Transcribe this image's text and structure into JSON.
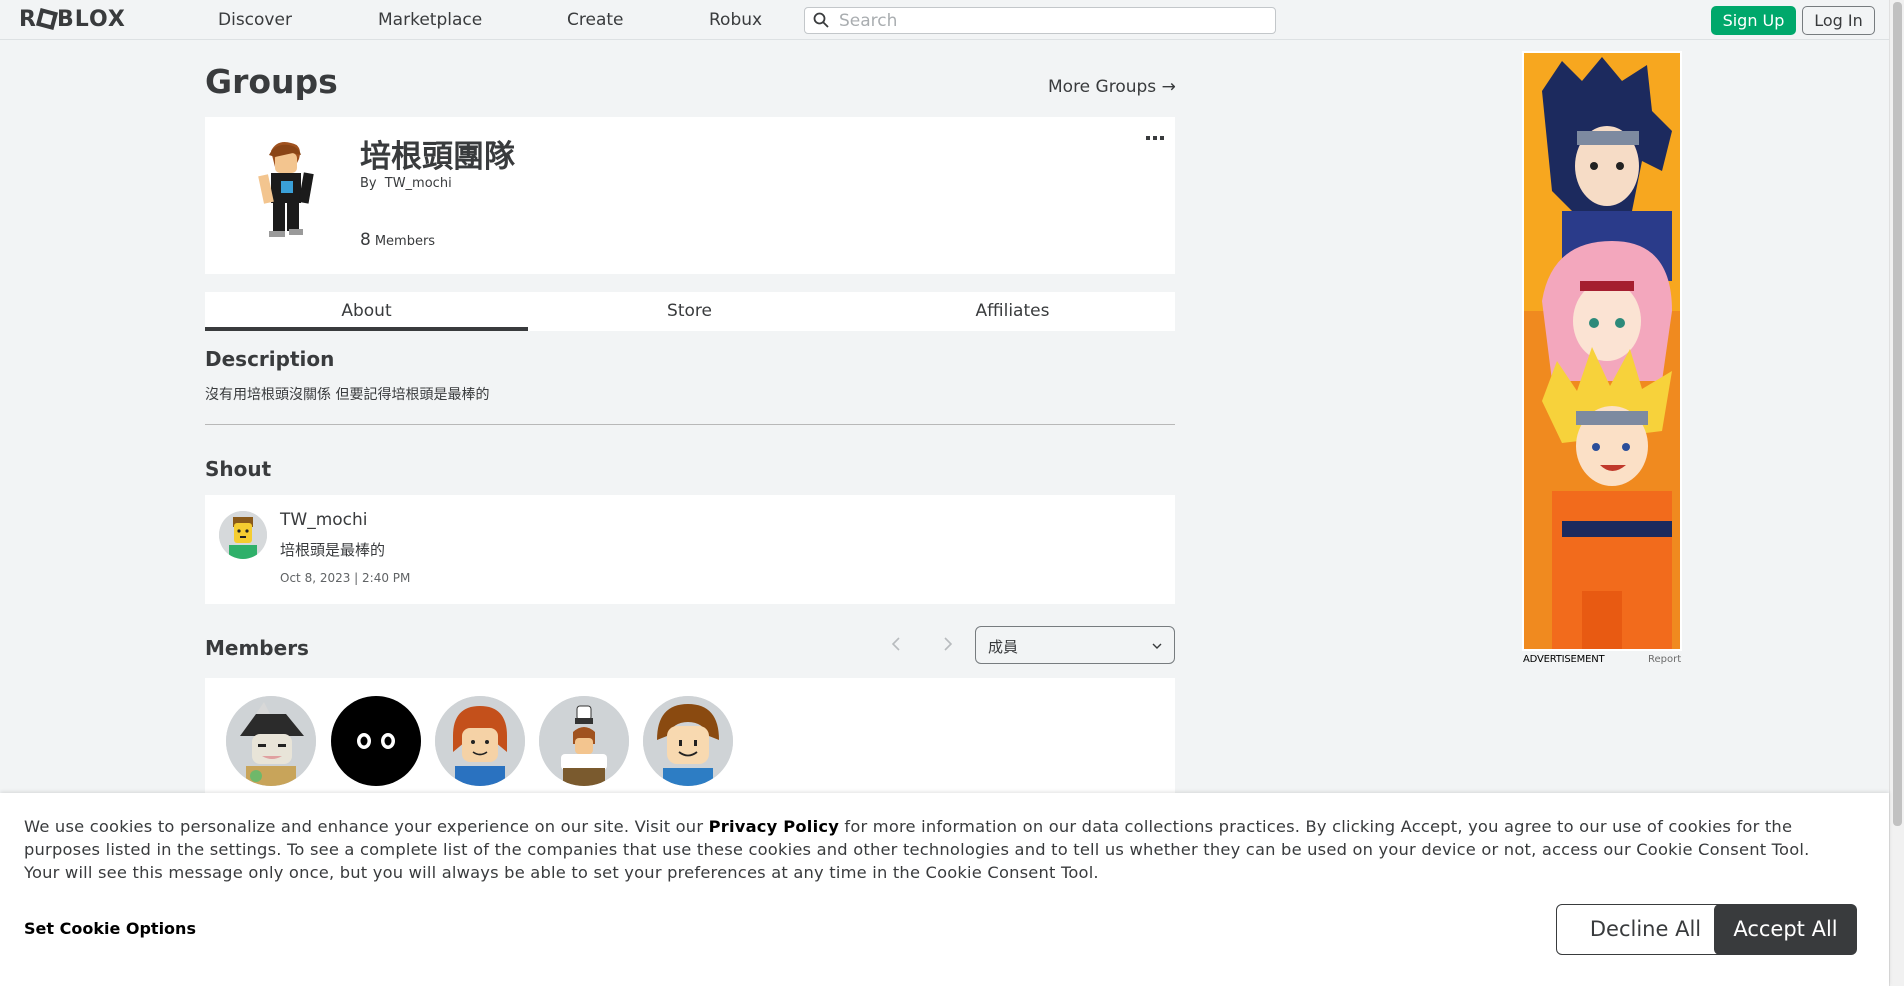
{
  "nav": {
    "logo": "ROBLOX",
    "links": [
      "Discover",
      "Marketplace",
      "Create",
      "Robux"
    ],
    "search_placeholder": "Search",
    "signup": "Sign Up",
    "login": "Log In"
  },
  "page": {
    "title": "Groups",
    "more_groups": "More Groups →"
  },
  "group": {
    "name": "培根頭團隊",
    "by_label": "By",
    "owner": "TW_mochi",
    "member_count": "8",
    "members_label": "Members"
  },
  "tabs": [
    "About",
    "Store",
    "Affiliates"
  ],
  "description": {
    "heading": "Description",
    "text": "沒有用培根頭沒關係 但要記得培根頭是最棒的"
  },
  "shout": {
    "heading": "Shout",
    "user": "TW_mochi",
    "body": "培根頭是最棒的",
    "date": "Oct 8, 2023 | 2:40 PM"
  },
  "members": {
    "heading": "Members",
    "role_selected": "成員"
  },
  "ad": {
    "label": "ADVERTISEMENT",
    "report": "Report"
  },
  "cookie": {
    "text_before": "We use cookies to personalize and enhance your experience on our site. Visit our ",
    "link": "Privacy Policy",
    "text_after": " for more information on our data collections practices. By clicking Accept, you agree to our use of cookies for the purposes listed in the settings. To see a complete list of the companies that use these cookies and other technologies and to tell us whether they can be used on your device or not, access our Cookie Consent Tool. Your will see this message only once, but you will always be able to set your preferences at any time in the Cookie Consent Tool.",
    "set_options": "Set Cookie Options",
    "decline": "Decline All",
    "accept": "Accept All"
  },
  "colors": {
    "accent_green": "#00a86b",
    "dark": "#393b3d",
    "background": "#f2f4f5"
  }
}
